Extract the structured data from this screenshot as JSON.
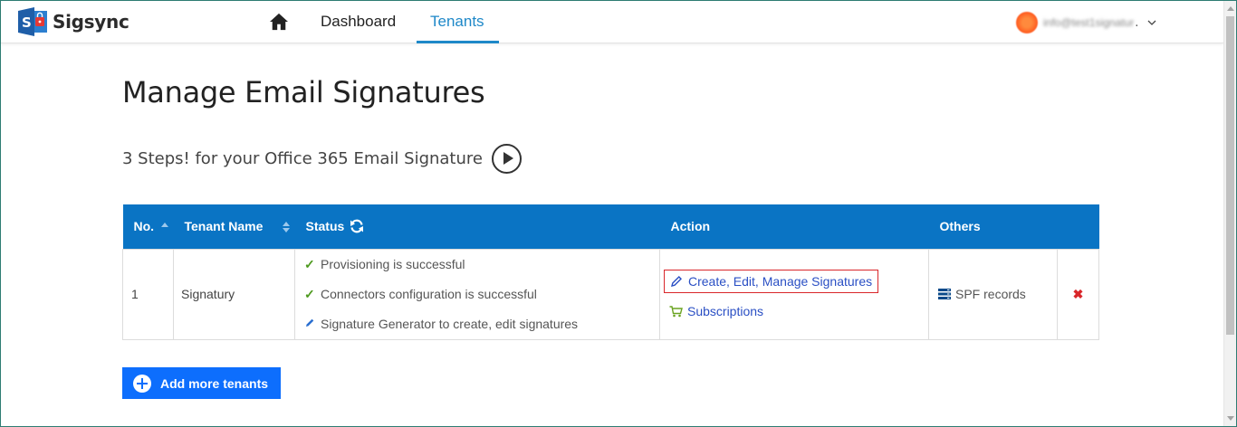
{
  "app": {
    "name": "Sigsync"
  },
  "nav": {
    "home_icon": "home-icon",
    "links": [
      {
        "label": "Dashboard",
        "active": false
      },
      {
        "label": "Tenants",
        "active": true
      }
    ],
    "accent": "#1e88c8"
  },
  "user": {
    "email": "info@test1signatur",
    "ellipsis": "."
  },
  "page": {
    "title": "Manage Email Signatures",
    "steps_text": "3 Steps! for your Office 365 Email Signature"
  },
  "table": {
    "headers": {
      "no": "No.",
      "name": "Tenant Name",
      "status": "Status",
      "action": "Action",
      "others": "Others"
    },
    "header_color": "#0a74c4",
    "rows": [
      {
        "no": "1",
        "name": "Signatury",
        "status": [
          {
            "icon": "check-icon",
            "text": "Provisioning is successful"
          },
          {
            "icon": "check-icon",
            "text": "Connectors configuration is successful"
          },
          {
            "icon": "pencil-icon",
            "text": "Signature Generator to create, edit signatures"
          }
        ],
        "actions": {
          "manage": "Create, Edit, Manage Signatures",
          "subscriptions": "Subscriptions"
        },
        "others": "SPF records",
        "delete": "✖"
      }
    ]
  },
  "add_button": {
    "label": "Add more tenants",
    "color": "#0d6efd"
  }
}
